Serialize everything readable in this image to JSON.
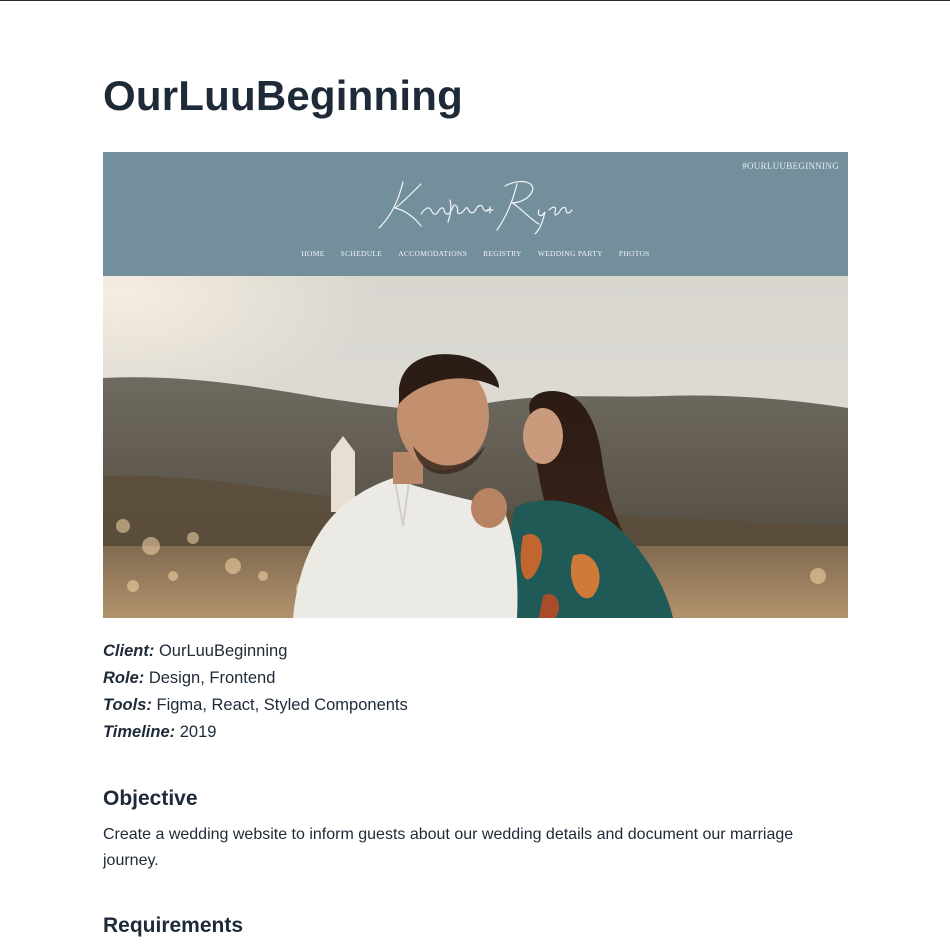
{
  "page": {
    "title": "OurLuuBeginning"
  },
  "hero": {
    "hashtag": "#OURLUUBEGINNING",
    "logo_text": "Kristina + Ryan",
    "nav": [
      "HOME",
      "SCHEDULE",
      "ACCOMODATIONS",
      "REGISTRY",
      "WEDDING PARTY",
      "PHOTOS"
    ],
    "header_color": "#738f9b"
  },
  "meta": {
    "client_label": "Client:",
    "client_value": "OurLuuBeginning",
    "role_label": "Role:",
    "role_value": "Design, Frontend",
    "tools_label": "Tools:",
    "tools_value": "Figma, React, Styled Components",
    "timeline_label": "Timeline:",
    "timeline_value": "2019"
  },
  "objective": {
    "title": "Objective",
    "text": "Create a wedding website to inform guests about our wedding details and document our marriage journey."
  },
  "requirements": {
    "title": "Requirements"
  }
}
